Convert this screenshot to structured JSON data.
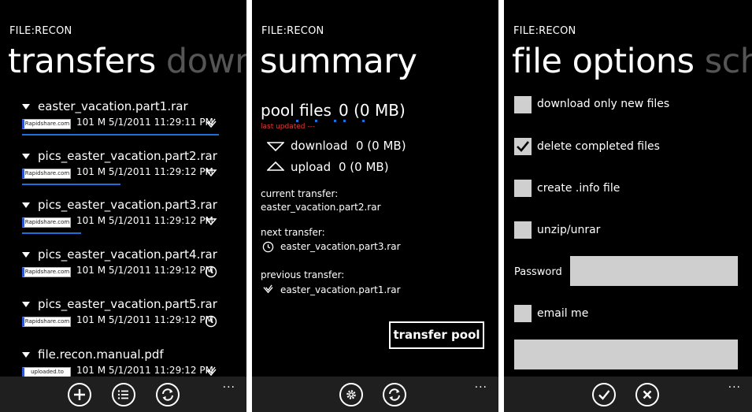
{
  "screens": [
    {
      "app_title": "FILE:RECON",
      "pivot": {
        "active": "transfers",
        "next": "down"
      },
      "items": [
        {
          "name": "easter_vacation.part1.rar",
          "host": "Rapidshare.com",
          "size": "101 M",
          "date": "5/1/2011 11:29:11 PM",
          "status_icon": "checked-clock-icon",
          "progress": 1.0
        },
        {
          "name": "pics_easter_vacation.part2.rar",
          "host": "Rapidshare.com",
          "size": "101 M",
          "date": "5/1/2011 11:29:12 PM",
          "status_icon": "download-arrow-icon",
          "progress": 0.5
        },
        {
          "name": "pics_easter_vacation.part3.rar",
          "host": "Rapidshare.com",
          "size": "101 M",
          "date": "5/1/2011 11:29:12 PM",
          "status_icon": "download-arrow-icon",
          "progress": 0.3
        },
        {
          "name": "pics_easter_vacation.part4.rar",
          "host": "Rapidshare.com",
          "size": "101 M",
          "date": "5/1/2011 11:29:12 PM",
          "status_icon": "clock-icon",
          "progress": 0
        },
        {
          "name": "pics_easter_vacation.part5.rar",
          "host": "Rapidshare.com",
          "size": "101 M",
          "date": "5/1/2011 11:29:12 PM",
          "status_icon": "clock-icon",
          "progress": 0
        },
        {
          "name": "file.recon.manual.pdf",
          "host": "uploaded.to",
          "size": "101 M",
          "date": "5/1/2011 11:29:12 PM",
          "status_icon": "checked-clock-icon",
          "progress": 0
        }
      ],
      "appbar": [
        "add-icon",
        "list-icon",
        "refresh-icon"
      ],
      "more": "..."
    },
    {
      "app_title": "FILE:RECON",
      "pivot": {
        "active": "summary"
      },
      "pool_label": "pool files",
      "pool_value": "0 (0 MB)",
      "last_updated": "last updated ---",
      "download_label": "download",
      "download_value": "0 (0 MB)",
      "upload_label": "upload",
      "upload_value": "0 (0 MB)",
      "current_transfer_label": "current transfer:",
      "current_transfer": "easter_vacation.part2.rar",
      "next_transfer_label": "next transfer:",
      "next_transfer": "easter_vacation.part3.rar",
      "previous_transfer_label": "previous transfer:",
      "previous_transfer": "easter_vacation.part1.rar",
      "transfer_pool_button": "transfer pool",
      "appbar": [
        "settings-icon",
        "refresh-icon"
      ],
      "more": "..."
    },
    {
      "app_title": "FILE:RECON",
      "pivot": {
        "active": "file options",
        "next": "sch"
      },
      "options": [
        {
          "label": "download only new files",
          "checked": false
        },
        {
          "label": "delete completed files",
          "checked": true
        },
        {
          "label": "create .info file",
          "checked": false
        },
        {
          "label": "unzip/unrar",
          "checked": false
        }
      ],
      "password_label": "Password",
      "password_value": "",
      "email_label": "email me",
      "email_checked": false,
      "email_value": "",
      "appbar": [
        "check-icon",
        "cancel-icon"
      ],
      "more": "..."
    }
  ],
  "colors": {
    "background": "#000000",
    "accent": "#1e6fd9",
    "appbar": "#1f1f1f",
    "field": "#cfcfcf",
    "last_updated": "#e53935"
  }
}
